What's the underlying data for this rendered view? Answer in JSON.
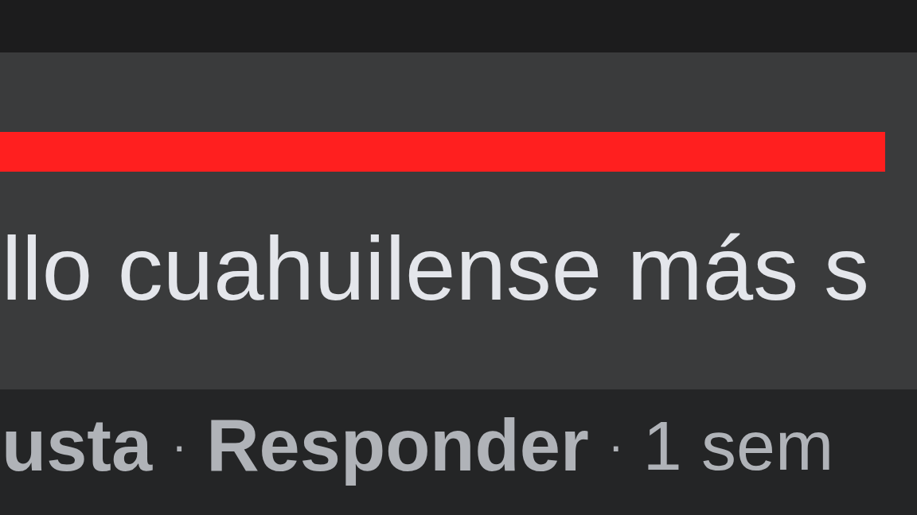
{
  "comment": {
    "redaction_bar": true,
    "lines": [
      "llo cuahuilense más s"
    ]
  },
  "footer": [
    {
      "text": "usta",
      "kind": "link"
    },
    {
      "text": "·",
      "kind": "dot"
    },
    {
      "text": "Responder",
      "kind": "link"
    },
    {
      "text": "·",
      "kind": "dot"
    },
    {
      "text": "1 sem",
      "kind": "time"
    }
  ]
}
